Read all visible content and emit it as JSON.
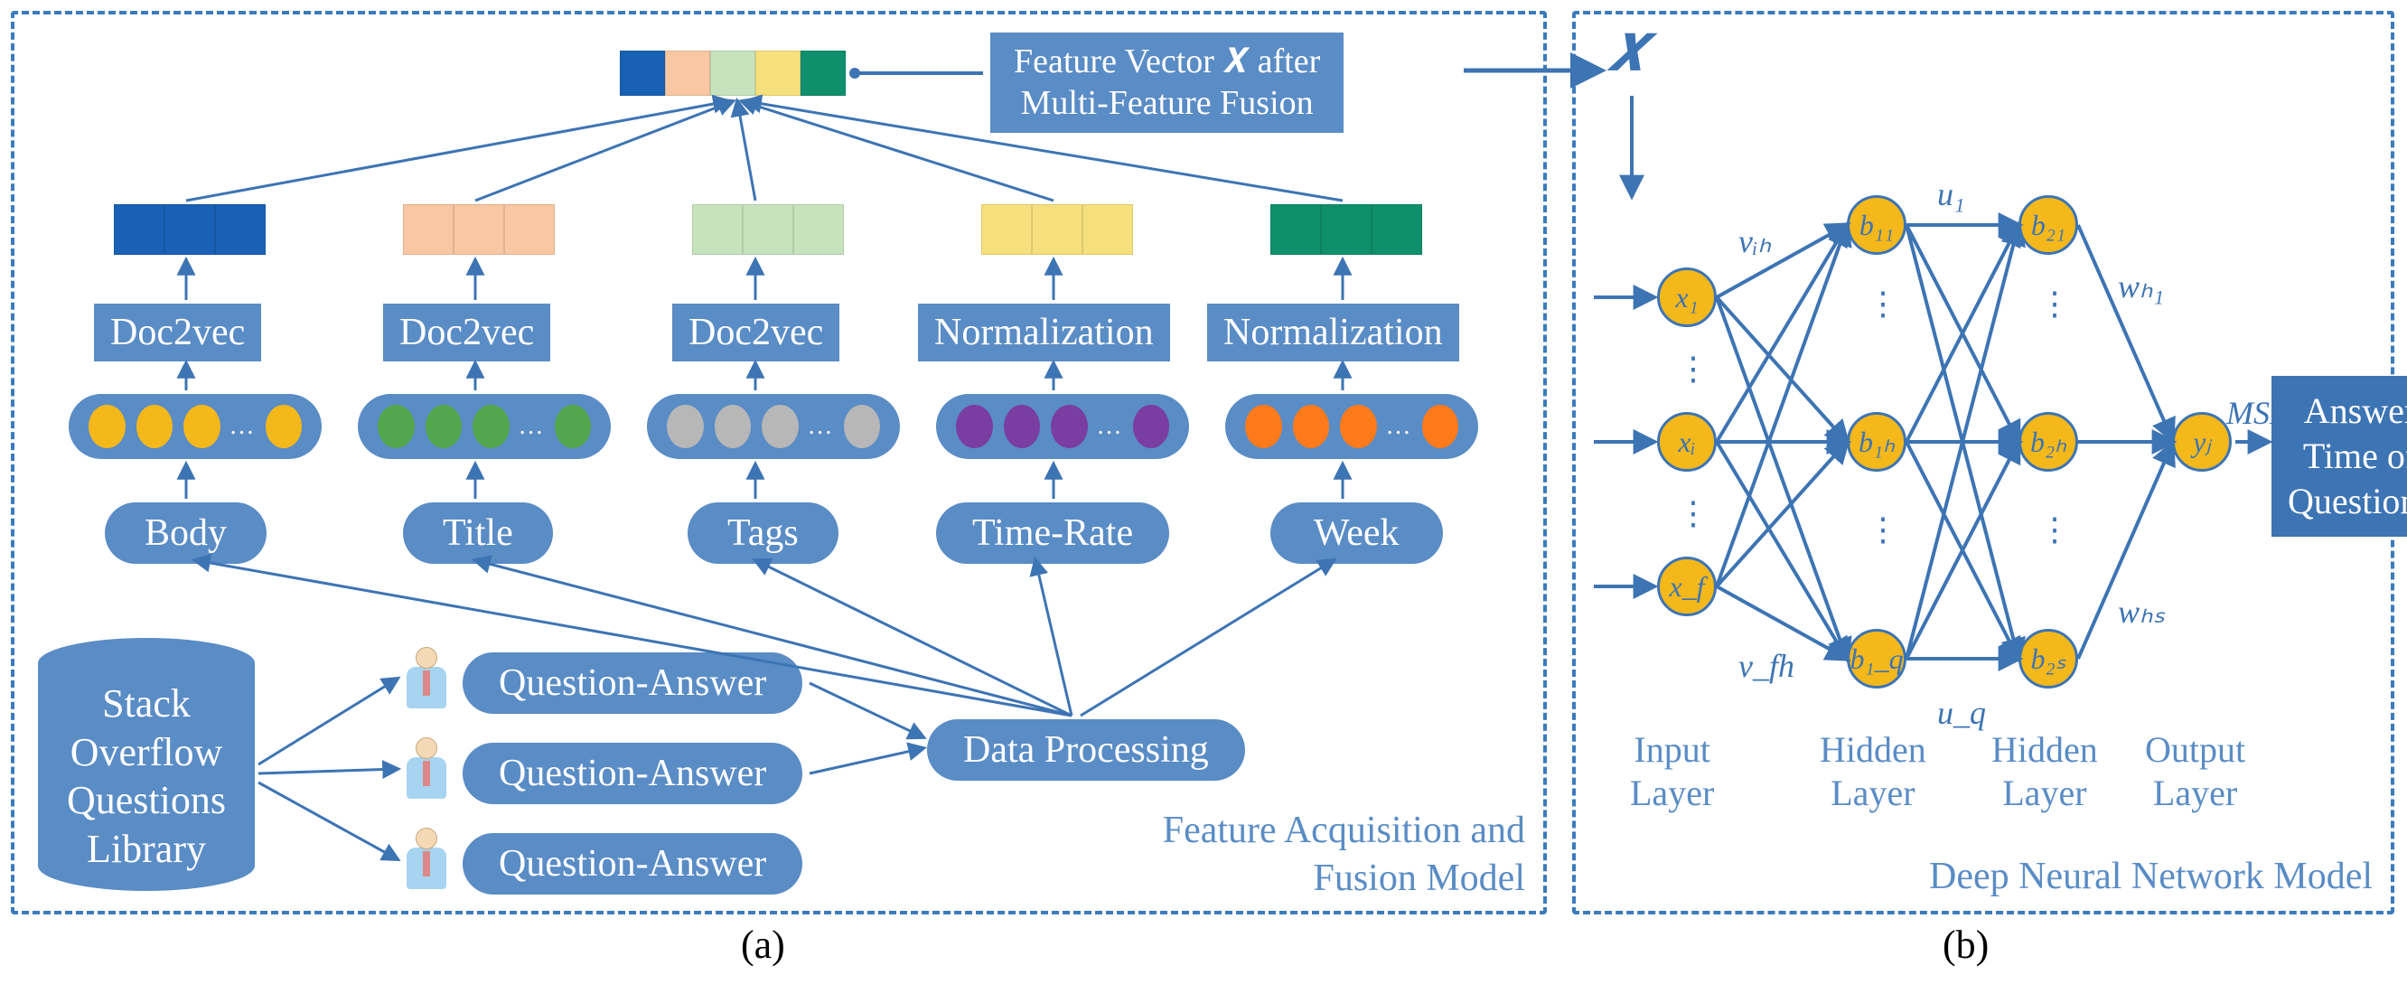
{
  "captions": {
    "a": "(a)",
    "b": "(b)"
  },
  "panelTitles": {
    "a": "Feature Acquisition and\nFusion Model",
    "b": "Deep Neural Network Model"
  },
  "cylinder": "Stack\nOverflow\nQuestions\nLibrary",
  "qa": [
    "Question-Answer",
    "Question-Answer",
    "Question-Answer"
  ],
  "dataProcessing": "Data Processing",
  "features": {
    "body": {
      "label": "Body",
      "op": "Doc2vec",
      "color": "#f5b81a",
      "sqColor": "#1861b5"
    },
    "title": {
      "label": "Title",
      "op": "Doc2vec",
      "color": "#54a64e",
      "sqColor": "#f9c7a3"
    },
    "tags": {
      "label": "Tags",
      "op": "Doc2vec",
      "color": "#b7b7b7",
      "sqColor": "#c7e3bd"
    },
    "time": {
      "label": "Time-Rate",
      "op": "Normalization",
      "color": "#7a3ea3",
      "sqColor": "#f6e07d"
    },
    "week": {
      "label": "Week",
      "op": "Normalization",
      "color": "#ff7a1a",
      "sqColor": "#0f8f6c"
    }
  },
  "fused": {
    "label": "Feature Vector 𝑿 after\nMulti-Feature Fusion",
    "colors": [
      "#1861b5",
      "#f9c7a3",
      "#c7e3bd",
      "#f6e07d",
      "#0f8f6c"
    ]
  },
  "Xsym": "𝑿",
  "nn": {
    "inputNodes": [
      "x₁",
      "xᵢ",
      "x_f"
    ],
    "h1Nodes": [
      "b₁₁",
      "b₁ₕ",
      "b₁_q"
    ],
    "h2Nodes": [
      "b₂₁",
      "b₂ₕ",
      "b₂ₛ"
    ],
    "outNode": "yⱼ",
    "weights": {
      "vih": "vᵢₕ",
      "vfh": "v_fh",
      "u1": "u₁",
      "uq": "u_q",
      "wh1": "wₕ₁",
      "whs": "wₕₛ",
      "mse": "MSE"
    },
    "layers": {
      "input": "Input\nLayer",
      "h1": "Hidden\nLayer",
      "h2": "Hidden\nLayer",
      "output": "Output\nLayer"
    },
    "answerBox": "Answer\nTime of\nQuestions"
  }
}
